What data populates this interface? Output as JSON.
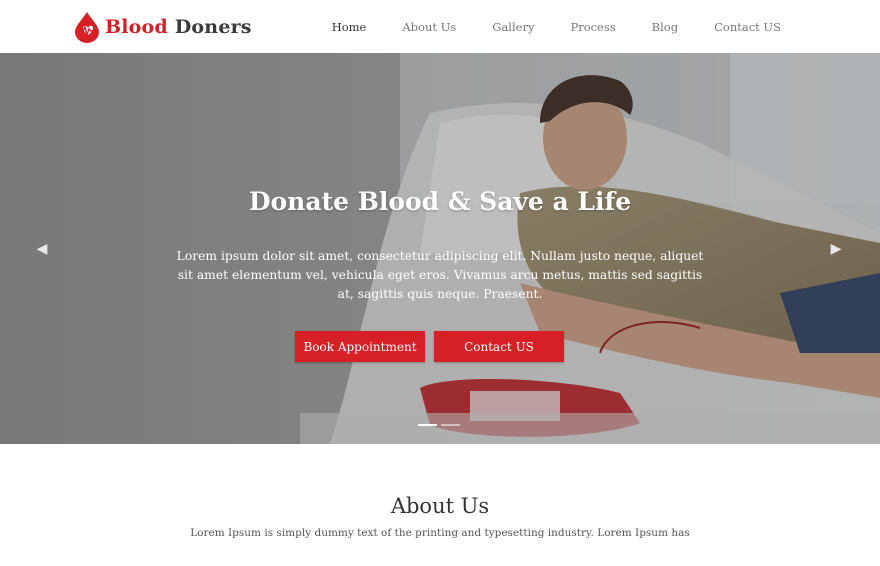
{
  "brand": {
    "word1": "Blood",
    "word2": "Doners",
    "primary_color": "#d71f26"
  },
  "nav": {
    "items": [
      {
        "label": "Home",
        "active": true
      },
      {
        "label": "About Us"
      },
      {
        "label": "Gallery"
      },
      {
        "label": "Process"
      },
      {
        "label": "Blog"
      },
      {
        "label": "Contact US"
      }
    ]
  },
  "hero": {
    "title": "Donate Blood & Save a Life",
    "text": "Lorem ipsum dolor sit amet, consectetur adipiscing elit. Nullam justo neque, aliquet sit amet elementum vel, vehicula eget eros. Vivamus arcu metus, mattis sed sagittis at, sagittis quis neque. Praesent.",
    "btn_book": "Book Appointment",
    "btn_contact": "Contact US",
    "prev_icon": "chevron-left-icon",
    "next_icon": "chevron-right-icon",
    "slide_count": 2,
    "active_slide": 1
  },
  "about": {
    "title": "About Us",
    "text": "Lorem Ipsum is simply dummy text of the printing and typesetting industry. Lorem Ipsum has"
  }
}
